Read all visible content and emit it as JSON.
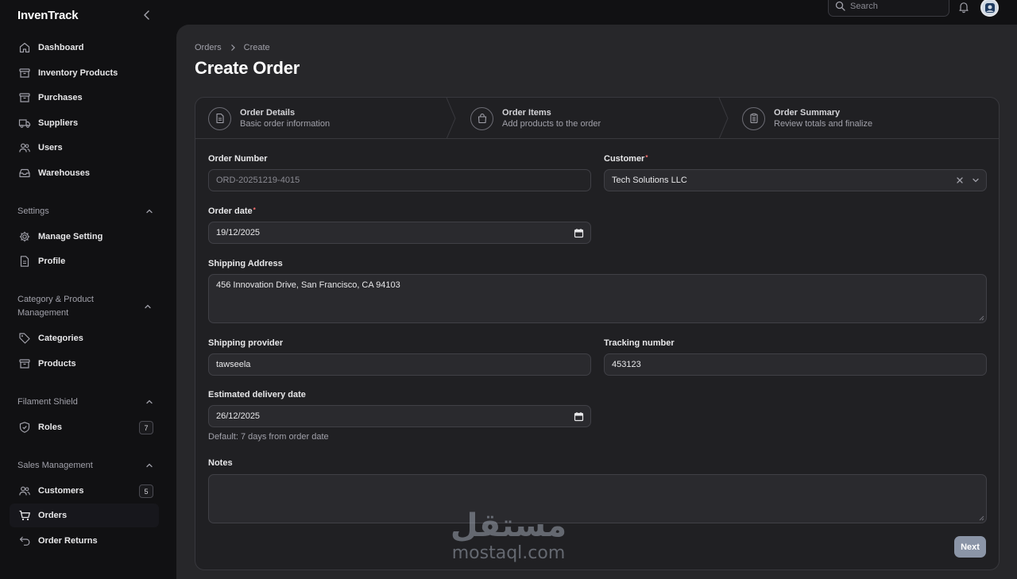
{
  "app": {
    "brand": "InvenTrack"
  },
  "sidebar": {
    "main_items": [
      {
        "label": "Dashboard"
      },
      {
        "label": "Inventory Products"
      },
      {
        "label": "Purchases"
      },
      {
        "label": "Suppliers"
      },
      {
        "label": "Users"
      },
      {
        "label": "Warehouses"
      }
    ],
    "groups": [
      {
        "title": "Settings",
        "items": [
          {
            "label": "Manage Setting"
          },
          {
            "label": "Profile"
          }
        ]
      },
      {
        "title": "Category & Product Management",
        "items": [
          {
            "label": "Categories"
          },
          {
            "label": "Products"
          }
        ]
      },
      {
        "title": "Filament Shield",
        "items": [
          {
            "label": "Roles",
            "badge": "7"
          }
        ]
      },
      {
        "title": "Sales Management",
        "items": [
          {
            "label": "Customers",
            "badge": "5"
          },
          {
            "label": "Orders",
            "active": true
          },
          {
            "label": "Order Returns"
          }
        ]
      }
    ]
  },
  "topbar": {
    "search_placeholder": "Search"
  },
  "breadcrumb": {
    "parent": "Orders",
    "current": "Create"
  },
  "page": {
    "title": "Create Order"
  },
  "wizard": {
    "steps": [
      {
        "title": "Order Details",
        "subtitle": "Basic order information",
        "icon": "document-icon"
      },
      {
        "title": "Order Items",
        "subtitle": "Add products to the order",
        "icon": "shopping-bag-icon"
      },
      {
        "title": "Order Summary",
        "subtitle": "Review totals and finalize",
        "icon": "clipboard-icon"
      }
    ]
  },
  "form": {
    "order_number": {
      "label": "Order Number",
      "value": "ORD-20251219-4015"
    },
    "customer": {
      "label": "Customer",
      "required_mark": "*",
      "value": "Tech Solutions LLC"
    },
    "order_date": {
      "label": "Order date",
      "required_mark": "*",
      "value": "19/12/2025"
    },
    "shipping_address": {
      "label": "Shipping Address",
      "value": "456 Innovation Drive, San Francisco, CA 94103"
    },
    "shipping_provider": {
      "label": "Shipping provider",
      "value": "tawseela"
    },
    "tracking_number": {
      "label": "Tracking number",
      "value": "453123"
    },
    "estimated_delivery": {
      "label": "Estimated delivery date",
      "value": "26/12/2025",
      "hint": "Default: 7 days from order date"
    },
    "notes": {
      "label": "Notes",
      "value": ""
    },
    "next_label": "Next"
  },
  "watermark": {
    "arabic": "مستقل",
    "latin": "mostaql.com"
  },
  "colors": {
    "background": "#111113",
    "panel": "#27272a",
    "card": "#202023",
    "primary_button": "#8b95a7",
    "required": "#f87171"
  }
}
